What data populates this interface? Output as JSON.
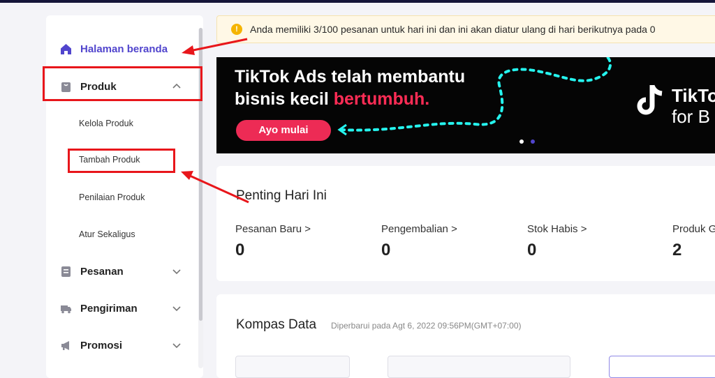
{
  "sidebar": {
    "home": {
      "label": "Halaman beranda"
    },
    "produk": {
      "label": "Produk"
    },
    "sub_items": [
      "Kelola Produk",
      "Tambah Produk",
      "Penilaian Produk",
      "Atur Sekaligus"
    ],
    "pesanan": {
      "label": "Pesanan"
    },
    "pengiriman": {
      "label": "Pengiriman"
    },
    "promosi": {
      "label": "Promosi"
    }
  },
  "notice": {
    "text": "Anda memiliki 3/100 pesanan untuk hari ini dan ini akan diatur ulang di hari berikutnya pada 0"
  },
  "banner": {
    "line1": "TikTok Ads telah membantu",
    "line2_prefix": "bisnis kecil ",
    "line2_highlight": "bertumbuh.",
    "cta": "Ayo mulai",
    "brand_line1": "TikTo",
    "brand_line2": "for B"
  },
  "penting": {
    "title": "Penting Hari Ini",
    "metrics": [
      {
        "label": "Pesanan Baru >",
        "value": "0"
      },
      {
        "label": "Pengembalian >",
        "value": "0"
      },
      {
        "label": "Stok Habis >",
        "value": "0"
      },
      {
        "label": "Produk G",
        "value": "2"
      }
    ]
  },
  "kompas": {
    "title": "Kompas Data",
    "updated": "Diperbarui pada Agt 6, 2022 09:56PM(GMT+07:00)"
  },
  "colors": {
    "accent": "#5145cd",
    "annotation": "#e8161b",
    "tiktok_red": "#fe2c55",
    "tiktok_cyan": "#25f4ee"
  }
}
